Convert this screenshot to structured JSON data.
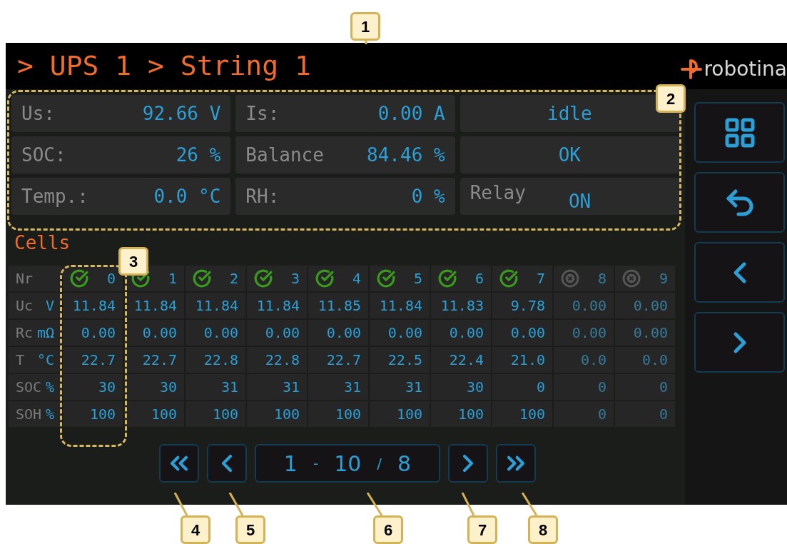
{
  "callouts": [
    "1",
    "2",
    "3",
    "4",
    "5",
    "6",
    "7",
    "8"
  ],
  "header": {
    "title": "> UPS 1 > String 1",
    "logo": "robotina"
  },
  "summary": [
    {
      "kind": "measure",
      "label": "Us:",
      "value": "92.66",
      "unit": "V"
    },
    {
      "kind": "measure",
      "label": "Is:",
      "value": "0.00",
      "unit": "A"
    },
    {
      "kind": "status",
      "value": "idle"
    },
    {
      "kind": "measure",
      "label": "SOC:",
      "value": "26",
      "unit": "%"
    },
    {
      "kind": "measure",
      "label": "Balance",
      "value": "84.46",
      "unit": "%"
    },
    {
      "kind": "status",
      "value": "OK"
    },
    {
      "kind": "measure",
      "label": "Temp.:",
      "value": "0.0",
      "unit": "°C"
    },
    {
      "kind": "measure",
      "label": "RH:",
      "value": "0",
      "unit": "%"
    },
    {
      "kind": "relay",
      "label": "Relay",
      "value": "ON"
    }
  ],
  "cells_title": "Cells",
  "table": {
    "header_label": "Nr",
    "rows": [
      {
        "label": "Uc",
        "unit": "V"
      },
      {
        "label": "Rc",
        "unit": "mΩ"
      },
      {
        "label": "T",
        "unit": "°C"
      },
      {
        "label": "SOC",
        "unit": "%"
      },
      {
        "label": "SOH",
        "unit": "%"
      }
    ],
    "columns": [
      {
        "nr": "0",
        "ok": true,
        "values": [
          "11.84",
          "0.00",
          "22.7",
          "30",
          "100"
        ]
      },
      {
        "nr": "1",
        "ok": true,
        "values": [
          "11.84",
          "0.00",
          "22.7",
          "30",
          "100"
        ]
      },
      {
        "nr": "2",
        "ok": true,
        "values": [
          "11.84",
          "0.00",
          "22.8",
          "31",
          "100"
        ]
      },
      {
        "nr": "3",
        "ok": true,
        "values": [
          "11.84",
          "0.00",
          "22.8",
          "31",
          "100"
        ]
      },
      {
        "nr": "4",
        "ok": true,
        "values": [
          "11.85",
          "0.00",
          "22.7",
          "31",
          "100"
        ]
      },
      {
        "nr": "5",
        "ok": true,
        "values": [
          "11.84",
          "0.00",
          "22.5",
          "31",
          "100"
        ]
      },
      {
        "nr": "6",
        "ok": true,
        "values": [
          "11.83",
          "0.00",
          "22.4",
          "30",
          "100"
        ]
      },
      {
        "nr": "7",
        "ok": true,
        "values": [
          "9.78",
          "0.00",
          "21.0",
          "0",
          "100"
        ]
      },
      {
        "nr": "8",
        "ok": false,
        "values": [
          "0.00",
          "0.00",
          "0.0",
          "0",
          "0"
        ]
      },
      {
        "nr": "9",
        "ok": false,
        "values": [
          "0.00",
          "0.00",
          "0.0",
          "0",
          "0"
        ]
      }
    ]
  },
  "pagination": {
    "from": "1",
    "dash": "-",
    "to": "10",
    "slash": "/",
    "total": "8"
  }
}
